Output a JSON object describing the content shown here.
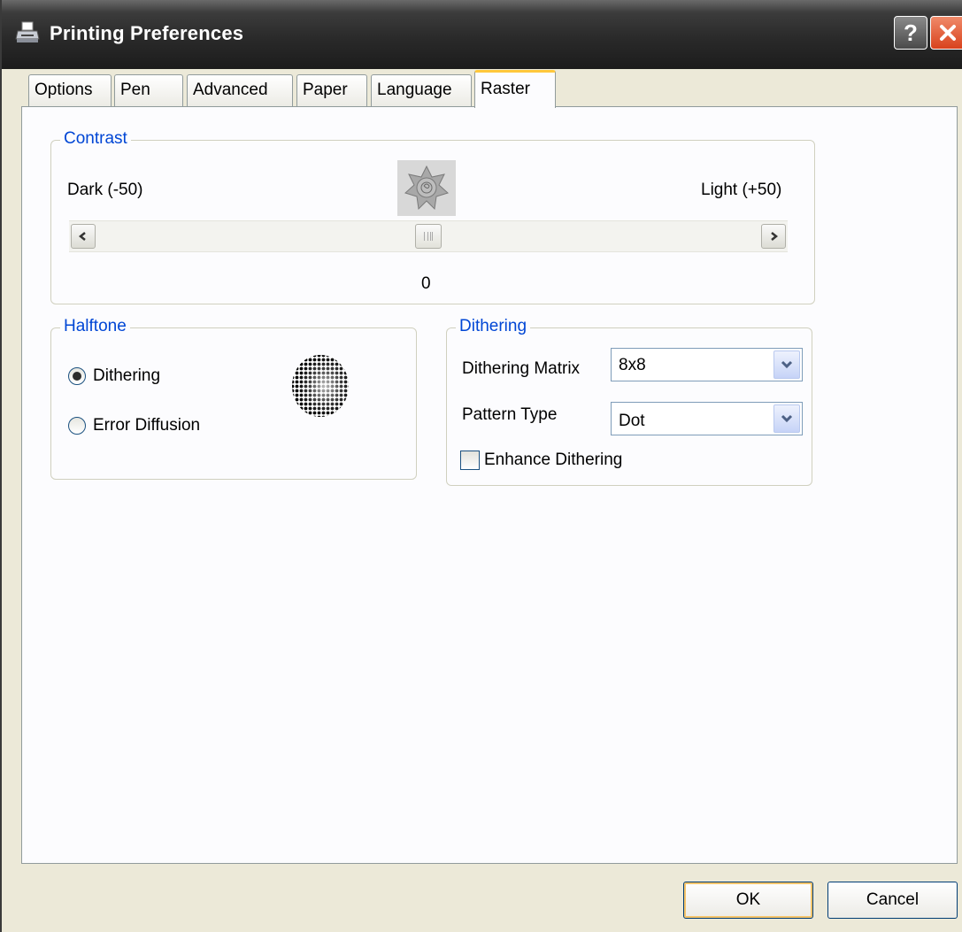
{
  "window": {
    "title": "Printing Preferences"
  },
  "tabs": [
    {
      "label": "Options"
    },
    {
      "label": "Pen"
    },
    {
      "label": "Advanced"
    },
    {
      "label": "Paper"
    },
    {
      "label": "Language"
    },
    {
      "label": "Raster",
      "active": true
    }
  ],
  "contrast": {
    "legend": "Contrast",
    "min_label": "Dark (-50)",
    "max_label": "Light (+50)",
    "value": "0",
    "slider_fraction": 0.5
  },
  "halftone": {
    "legend": "Halftone",
    "options": [
      {
        "label": "Dithering",
        "checked": true
      },
      {
        "label": "Error Diffusion",
        "checked": false
      }
    ]
  },
  "dithering": {
    "legend": "Dithering",
    "matrix_label": "Dithering Matrix",
    "matrix_value": "8x8",
    "pattern_label": "Pattern Type",
    "pattern_value": "Dot",
    "enhance_label": "Enhance Dithering",
    "enhance_checked": false
  },
  "buttons": {
    "ok": "OK",
    "cancel": "Cancel"
  },
  "icons": {
    "title": "printer-icon",
    "contrast_preview": "contrast-preview-icon",
    "halftone_preview": "halftone-preview-icon"
  }
}
